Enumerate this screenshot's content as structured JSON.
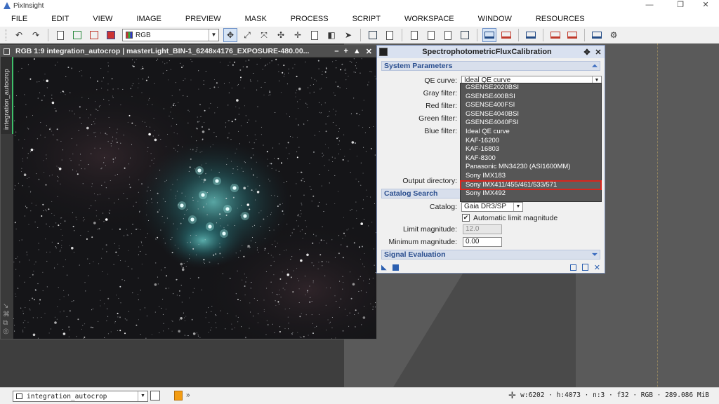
{
  "titlebar": {
    "app_title": "PixInsight",
    "min": "—",
    "restore": "❐",
    "close": "✕"
  },
  "menu": [
    "FILE",
    "EDIT",
    "VIEW",
    "IMAGE",
    "PREVIEW",
    "MASK",
    "PROCESS",
    "SCRIPT",
    "WORKSPACE",
    "WINDOW",
    "RESOURCES"
  ],
  "toolbar": {
    "channel_select": "RGB",
    "channel_dropdown": "▼"
  },
  "image_window": {
    "title": "RGB 1:9 integration_autocrop | masterLight_BIN-1_6248x4176_EXPOSURE-480.00...",
    "side_tab": "integration_autocrop",
    "ctl_min": "–",
    "ctl_max": "+",
    "ctl_shade": "▲",
    "ctl_close": "✕"
  },
  "dialog": {
    "title": "SpectrophotometricFluxCalibration",
    "system_parameters": "System Parameters",
    "qe_label": "QE curve:",
    "qe_value": "Ideal QE curve",
    "gray_label": "Gray filter:",
    "red_label": "Red filter:",
    "green_label": "Green filter:",
    "blue_label": "Blue filter:",
    "output_label": "Output directory:",
    "catalog_search": "Catalog Search",
    "catalog_label": "Catalog:",
    "catalog_value": "Gaia DR3/SP",
    "auto_limit_label": "Automatic limit magnitude",
    "auto_limit_checked": true,
    "limit_label": "Limit magnitude:",
    "limit_value": "12.0",
    "minmag_label": "Minimum magnitude:",
    "minmag_value": "0.00",
    "signal_evaluation": "Signal Evaluation",
    "qe_options": [
      "GSENSE2020BSI",
      "GSENSE400BSI",
      "GSENSE400FSI",
      "GSENSE4040BSI",
      "GSENSE4040FSI",
      "Ideal QE curve",
      "KAF-16200",
      "KAF-16803",
      "KAF-8300",
      "Panasonic MN34230 (ASI1600MM)",
      "Sony IMX183",
      "Sony IMX411/455/461/533/571",
      "Sony IMX492"
    ],
    "highlighted_option_index": 11
  },
  "statusbar": {
    "view_select": "integration_autocrop",
    "info": "w:6202 · h:4073 · n:3 · f32 · RGB · 289.086 MiB"
  }
}
